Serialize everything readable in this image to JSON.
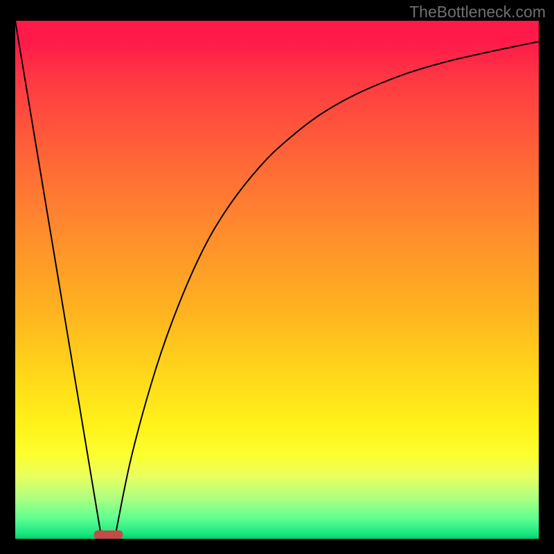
{
  "watermark": "TheBottleneck.com",
  "colors": {
    "frame": "#000000",
    "curve": "#000000",
    "marker": "#c54a4a",
    "watermark_text": "#707070"
  },
  "chart_data": {
    "type": "line",
    "title": "",
    "xlabel": "",
    "ylabel": "",
    "xlim": [
      0,
      100
    ],
    "ylim": [
      0,
      100
    ],
    "annotations": [
      "TheBottleneck.com"
    ],
    "series": [
      {
        "name": "left-segment",
        "x": [
          0,
          16.5
        ],
        "values": [
          100,
          0
        ]
      },
      {
        "name": "right-segment",
        "x": [
          19,
          22,
          26,
          30,
          35,
          40,
          46,
          52,
          60,
          70,
          82,
          100
        ],
        "values": [
          0,
          15,
          30,
          42,
          54,
          63,
          71,
          77,
          83,
          88,
          92,
          96
        ]
      }
    ],
    "marker": {
      "x_center": 17.8,
      "y": 0.8,
      "width": 5.5,
      "height": 1.6,
      "shape": "rounded-rect"
    },
    "gradient_stops": [
      {
        "pos": 0,
        "color": "#ff1a4a"
      },
      {
        "pos": 28,
        "color": "#ff6a36"
      },
      {
        "pos": 55,
        "color": "#ffb020"
      },
      {
        "pos": 78,
        "color": "#fff21a"
      },
      {
        "pos": 92,
        "color": "#b0ff80"
      },
      {
        "pos": 100,
        "color": "#00d070"
      }
    ]
  }
}
